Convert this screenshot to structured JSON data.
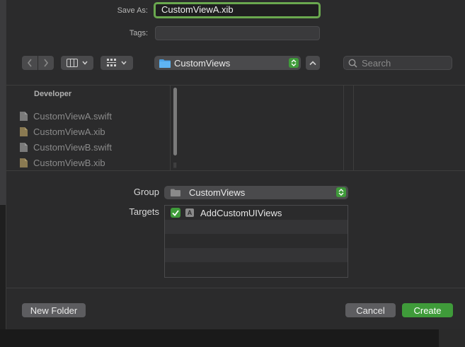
{
  "save_as": {
    "label": "Save As:",
    "value": "CustomViewA.xib"
  },
  "tags": {
    "label": "Tags:",
    "value": ""
  },
  "toolbar": {
    "back_icon": "chevron-left-icon",
    "forward_icon": "chevron-right-icon",
    "column_view_icon": "columns-icon",
    "group_icon": "grid-icon",
    "location": "CustomViews",
    "search_placeholder": "Search"
  },
  "sidebar": {
    "header": "Developer",
    "files": [
      {
        "name": "CustomViewA.swift",
        "icon": "swift-file-icon"
      },
      {
        "name": "CustomViewA.xib",
        "icon": "xib-file-icon"
      },
      {
        "name": "CustomViewB.swift",
        "icon": "swift-file-icon"
      },
      {
        "name": "CustomViewB.xib",
        "icon": "xib-file-icon"
      }
    ]
  },
  "form": {
    "group_label": "Group",
    "group_value": "CustomViews",
    "targets_label": "Targets",
    "targets": [
      {
        "name": "AddCustomUIViews",
        "checked": true
      }
    ]
  },
  "footer": {
    "new_folder": "New Folder",
    "cancel": "Cancel",
    "create": "Create"
  },
  "colors": {
    "accent_green": "#3f9b3a",
    "folder_blue": "#4aa3e8",
    "focus_ring": "#6aa84f"
  }
}
